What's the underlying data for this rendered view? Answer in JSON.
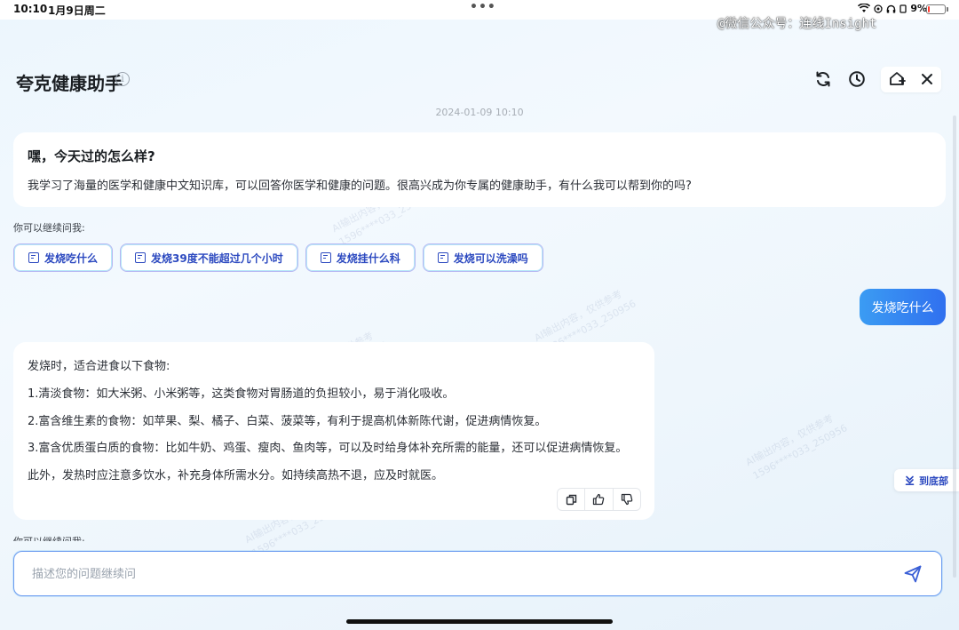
{
  "status_bar": {
    "time": "10:10",
    "date": "1月9日周二",
    "more_dots": "•••",
    "battery": "9%",
    "battery_level": 0.09
  },
  "source_watermark": "@微信公众号：连线Insight",
  "header": {
    "title": "夸克健康助手",
    "info_glyph": "i"
  },
  "timestamp": "2024-01-09 10:10",
  "greeting": {
    "title": "嘿，今天过的怎么样?",
    "body": "我学习了海量的医学和健康中文知识库，可以回答你医学和健康的问题。很高兴成为你专属的健康助手，有什么我可以帮到你的吗?"
  },
  "suggestions": {
    "label": "你可以继续问我:",
    "items": [
      "发烧吃什么",
      "发烧39度不能超过几个小时",
      "发烧挂什么科",
      "发烧可以洗澡吗"
    ]
  },
  "user_message": "发烧吃什么",
  "answer": {
    "lines": [
      "发烧时，适合进食以下食物:",
      "1.清淡食物：如大米粥、小米粥等，这类食物对胃肠道的负担较小，易于消化吸收。",
      "2.富含维生素的食物：如苹果、梨、橘子、白菜、菠菜等，有利于提高机体新陈代谢，促进病情恢复。",
      "3.富含优质蛋白质的食物：比如牛奶、鸡蛋、瘦肉、鱼肉等，可以及时给身体补充所需的能量，还可以促进病情恢复。",
      "此外，发热时应注意多饮水，补充身体所需水分。如持续高热不退，应及时就医。"
    ]
  },
  "scroll_to_bottom": "到底部",
  "partial_label": "你可以继续问我:",
  "input": {
    "placeholder": "描述您的问题继续问",
    "value": ""
  },
  "content_watermark": {
    "line1": "AI输出内容，仅供参考",
    "line2": "1596****033_250956"
  },
  "colors": {
    "accent": "#2d4ac0",
    "user_bubble_start": "#3b9cf3",
    "user_bubble_end": "#3070ef",
    "battery_low": "#ff3b30"
  },
  "icons": {
    "refresh": "refresh-icon",
    "history": "clock-icon",
    "new_chat": "add-home-icon",
    "close": "close-icon",
    "copy": "copy-icon",
    "like": "thumbs-up-icon",
    "dislike": "thumbs-down-icon",
    "send": "send-icon",
    "to_bottom": "arrow-down-to-line-icon"
  }
}
